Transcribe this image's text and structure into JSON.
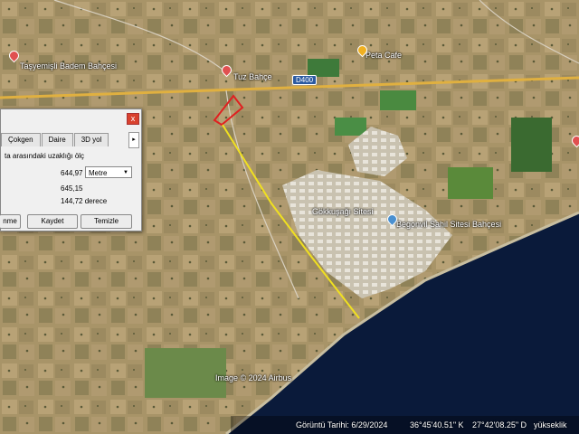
{
  "map": {
    "places": [
      {
        "name": "Taşyemişli Badem Bahçesi",
        "label": "Taşyemişli Badem Bahçesi"
      },
      {
        "name": "Bahçe",
        "label": "Tuz Bahçe"
      },
      {
        "name": "Peta Cafe",
        "label": "Peta Cafe"
      },
      {
        "name": "Gökkuşağı Sitesi",
        "label": "Gökkuşağı Sitesi"
      },
      {
        "name": "Begonvil Sahil Sitesi Bahçe",
        "label": "Begonvil Sahil Sitesi Bahçesi"
      }
    ],
    "road_label": "D400",
    "attribution": "Image © 2024 Airbus",
    "status": {
      "date": "Görüntü Tarihi: 6/29/2024",
      "lat": "36°45'40.51\" K",
      "lon": "27°42'08.25\" D",
      "elev": "yükseklik"
    },
    "colors": {
      "path": "#f0e020",
      "polygon": "#e02020",
      "water": "#0a1a3a"
    }
  },
  "panel": {
    "close": "x",
    "tabs": [
      "Çokgen",
      "Daire",
      "3D yol"
    ],
    "tab_arrow": "▸",
    "description": "ta arasındaki uzaklığı ölç",
    "length_value": "644,97",
    "unit": "Metre",
    "ground_value": "645,15",
    "heading_value": "144,72 derece",
    "buttons": {
      "first": "nme",
      "save": "Kaydet",
      "clear": "Temizle"
    }
  }
}
